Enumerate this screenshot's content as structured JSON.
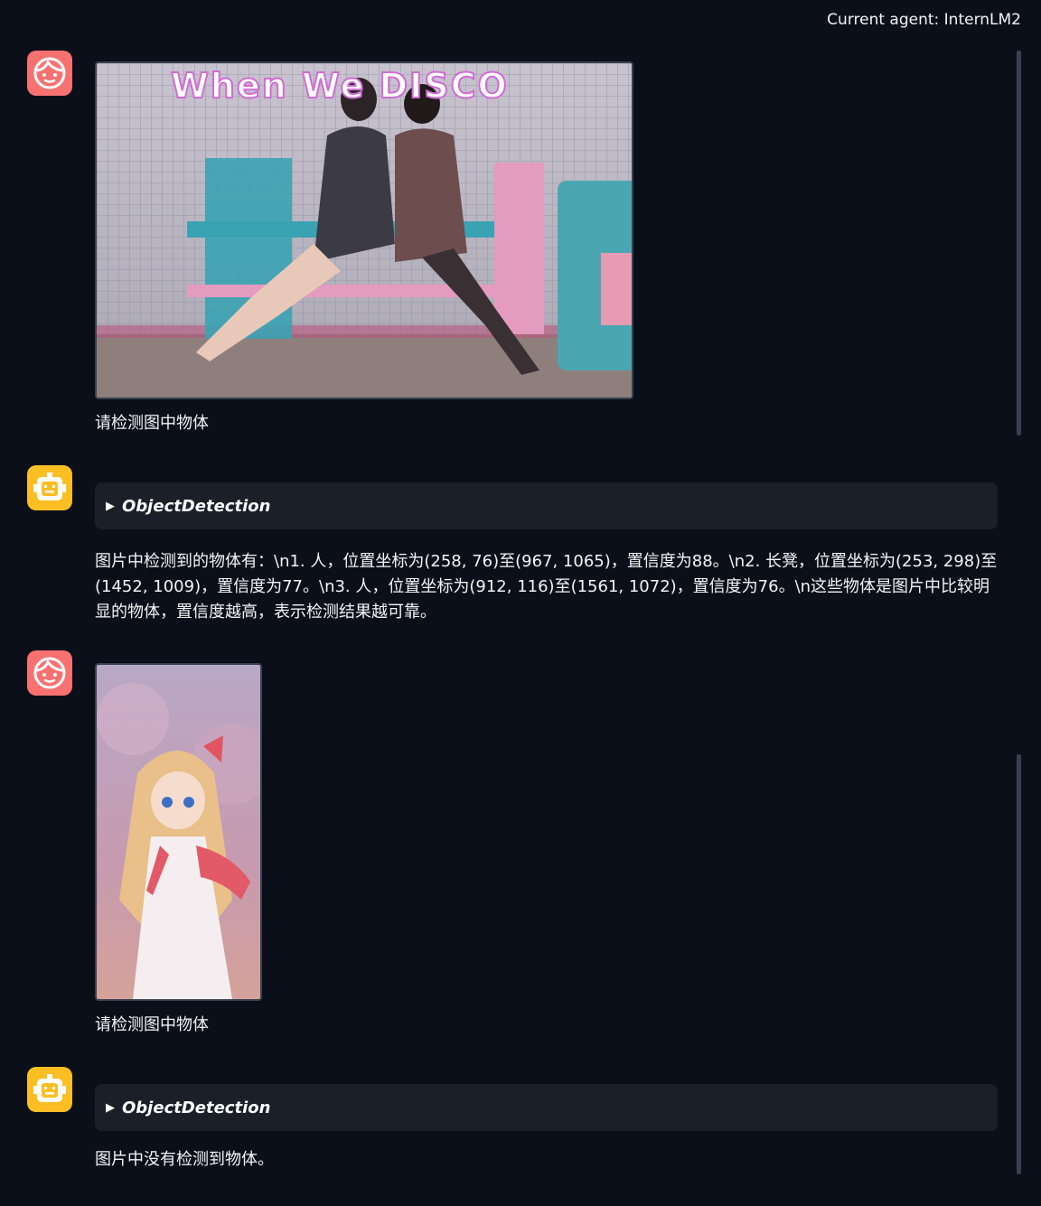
{
  "header": {
    "current_agent": "Current agent: InternLM2"
  },
  "messages": [
    {
      "role": "user",
      "image": {
        "title": "When We DISCO",
        "alt": "two girls on bench"
      },
      "text": "请检测图中物体"
    },
    {
      "role": "bot",
      "tool": "ObjectDetection",
      "text": "图片中检测到的物体有：\\n1. 人，位置坐标为(258, 76)至(967, 1065)，置信度为88。\\n2. 长凳，位置坐标为(253, 298)至(1452, 1009)，置信度为77。\\n3. 人，位置坐标为(912, 116)至(1561, 1072)，置信度为76。\\n这些物体是图片中比较明显的物体，置信度越高，表示检测结果越可靠。"
    },
    {
      "role": "user",
      "image": {
        "alt": "anime girl"
      },
      "text": "请检测图中物体"
    },
    {
      "role": "bot",
      "tool": "ObjectDetection",
      "text": "图片中没有检测到物体。"
    }
  ],
  "colors": {
    "user_avatar": "#f87171",
    "bot_avatar": "#fbbf24",
    "background": "#0b0f19",
    "tool_panel": "#1a1f28"
  },
  "icons": {
    "user": "user-face-icon",
    "bot": "robot-icon",
    "tool": "triangle-right-icon"
  }
}
